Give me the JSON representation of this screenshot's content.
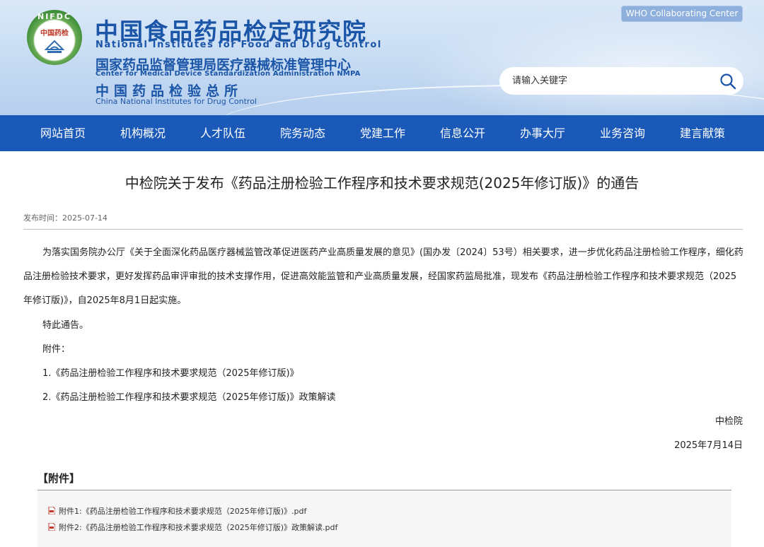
{
  "header": {
    "logo_ring_text": "NIFDC",
    "logo_center_text": "中国药检",
    "title_cn": "中国食品药品检定研究院",
    "title_en": "National Institutes for Food and Drug Control",
    "sub_cn": "国家药品监督管理局医疗器械标准管理中心",
    "sub_en": "Center for Medical Device Standardization Administration NMPA",
    "sub2_cn": "中国药品检验总所",
    "sub2_en": "China National Institutes for Drug Control",
    "who_label": "WHO Collaborating Center",
    "search_placeholder": "请输入关键字"
  },
  "nav": {
    "items": [
      "网站首页",
      "机构概况",
      "人才队伍",
      "院务动态",
      "党建工作",
      "信息公开",
      "办事大厅",
      "业务咨询",
      "建言献策"
    ]
  },
  "article": {
    "title": "中检院关于发布《药品注册检验工作程序和技术要求规范(2025年修订版)》的通告",
    "publish_time": "发布时间：2025-07-14",
    "paragraph": "为落实国务院办公厅《关于全面深化药品医疗器械监管改革促进医药产业高质量发展的意见》(国办发〔2024〕53号）相关要求，进一步优化药品注册检验工作程序，细化药品注册检验技术要求，更好发挥药品审评审批的技术支撑作用，促进高效能监管和产业高质量发展，经国家药监局批准，现发布《药品注册检验工作程序和技术要求规范（2025年修订版)》，自2025年8月1日起实施。",
    "notice": "特此通告。",
    "attachments_label": "附件：",
    "attachment_1": "1.《药品注册检验工作程序和技术要求规范（2025年修订版)》",
    "attachment_2": "2.《药品注册检验工作程序和技术要求规范（2025年修订版)》政策解读",
    "signer": "中检院",
    "date": "2025年7月14日"
  },
  "attachments": {
    "heading": "【附件】",
    "files": [
      "附件1:《药品注册检验工作程序和技术要求规范（2025年修订版)》.pdf",
      "附件2:《药品注册检验工作程序和技术要求规范（2025年修订版)》政策解读.pdf"
    ]
  },
  "colors": {
    "brand_blue": "#1b55a8",
    "nav_blue": "#1a59b8",
    "logo_green": "#3f8f3a"
  }
}
